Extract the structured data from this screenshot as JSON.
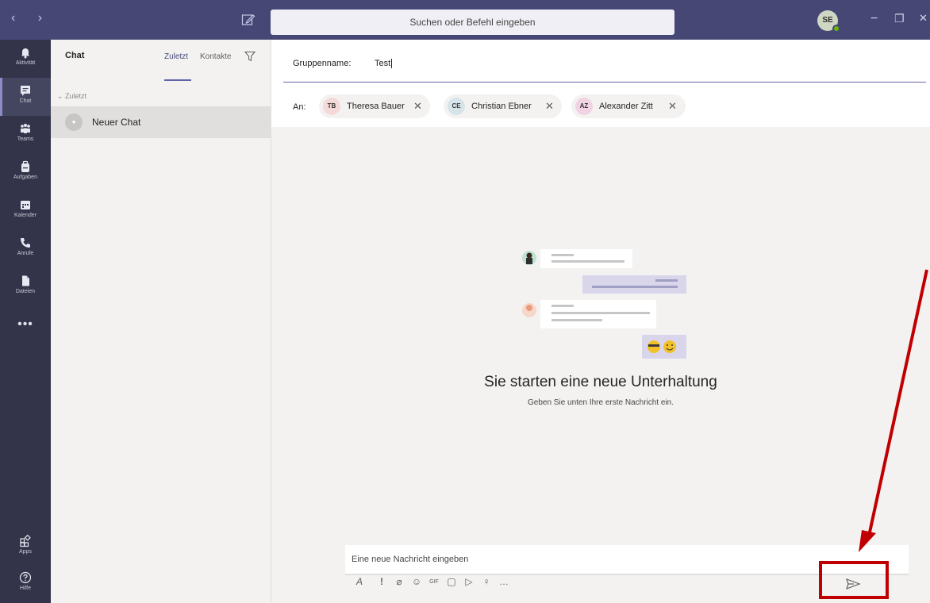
{
  "titlebar": {
    "nav_arrows": "‹ ›",
    "search_placeholder": "Suchen oder Befehl eingeben",
    "user_initials": "SE",
    "minimize": "−",
    "maximize": "❐",
    "close": "✕"
  },
  "rail": {
    "items": [
      {
        "label": "Aktivität",
        "icon": "bell-icon"
      },
      {
        "label": "Chat",
        "icon": "chat-icon"
      },
      {
        "label": "Teams",
        "icon": "teams-icon"
      },
      {
        "label": "Aufgaben",
        "icon": "briefcase-icon"
      },
      {
        "label": "Kalender",
        "icon": "calendar-icon"
      },
      {
        "label": "Anrufe",
        "icon": "phone-icon"
      },
      {
        "label": "Dateien",
        "icon": "file-icon"
      }
    ],
    "more": "•••",
    "apps_label": "Apps",
    "help_label": "Hilfe"
  },
  "chat_list": {
    "title": "Chat",
    "tab_recent": "Zuletzt",
    "tab_contacts": "Kontakte",
    "section_label": "Zuletzt",
    "new_chat_label": "Neuer Chat"
  },
  "header": {
    "groupname_label": "Gruppenname:",
    "groupname_value": "Test",
    "to_label": "An:",
    "recipients": [
      {
        "initials": "TB",
        "name": "Theresa Bauer",
        "color": "#f4d9d9"
      },
      {
        "initials": "CE",
        "name": "Christian Ebner",
        "color": "#d6e4ea"
      },
      {
        "initials": "AZ",
        "name": "Alexander Zitt",
        "color": "#f1d4e4"
      }
    ]
  },
  "empty_state": {
    "title": "Sie starten eine neue Unterhaltung",
    "subtitle": "Geben Sie unten Ihre erste Nachricht ein."
  },
  "composer": {
    "placeholder": "Eine neue Nachricht eingeben",
    "toolbar": [
      "format-icon",
      "important-icon",
      "attach-icon",
      "emoji-icon",
      "gif-icon",
      "sticker-icon",
      "meet-icon",
      "praise-icon",
      "more-icon"
    ]
  },
  "colors": {
    "titlebar": "#464775",
    "rail": "#33344a",
    "accent": "#6264a7",
    "annotation": "#c00000"
  }
}
